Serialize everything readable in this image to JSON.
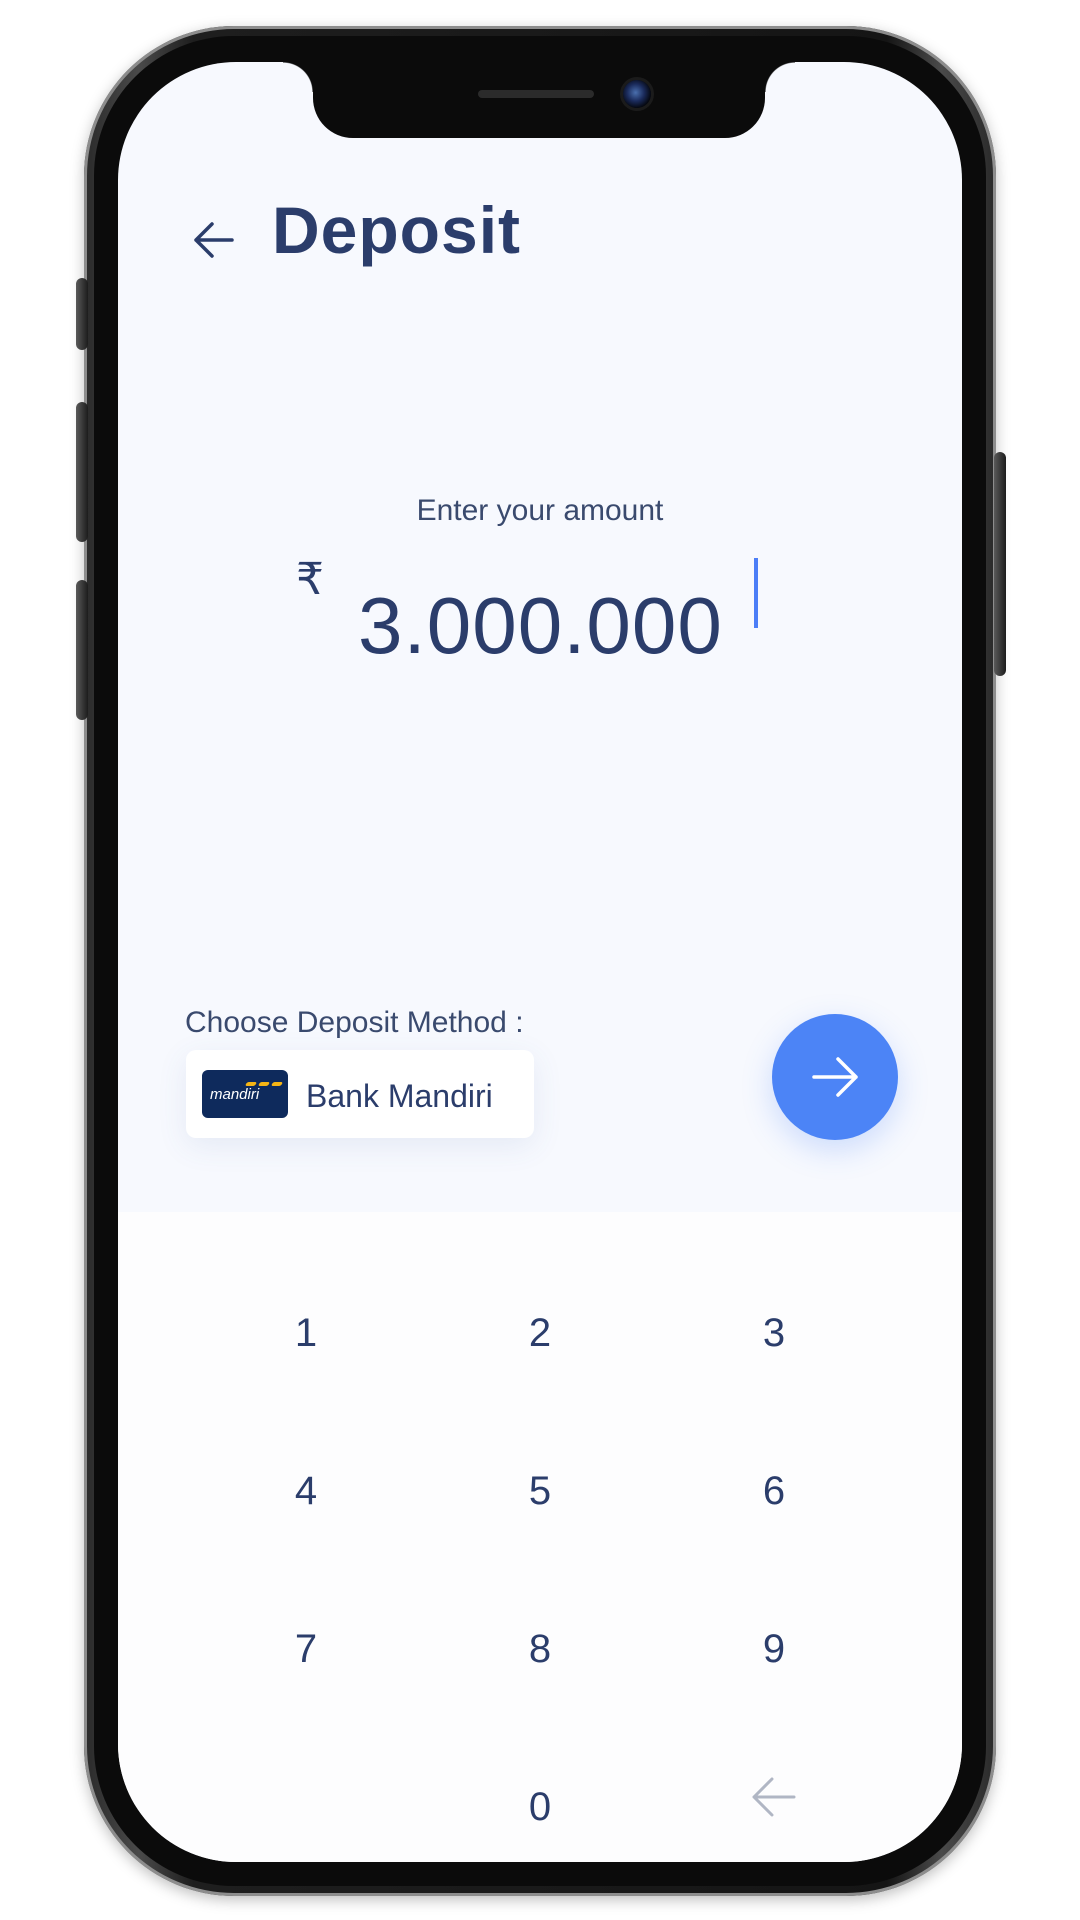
{
  "header": {
    "title": "Deposit",
    "back_icon": "arrow-left-icon"
  },
  "amount": {
    "label": "Enter your amount",
    "currency_symbol": "₹",
    "value": "3.000.000"
  },
  "deposit_method": {
    "label": "Choose Deposit Method :",
    "selected": {
      "logo_text": "mandiri",
      "name": "Bank Mandiri"
    }
  },
  "next_button": {
    "icon": "arrow-right-icon"
  },
  "keypad": {
    "keys": [
      "1",
      "2",
      "3",
      "4",
      "5",
      "6",
      "7",
      "8",
      "9",
      "0"
    ],
    "backspace_icon": "arrow-left-icon"
  },
  "colors": {
    "accent": "#4c84f6",
    "text": "#2b3d6b",
    "background": "#f7f9fe",
    "bank_logo_bg": "#0e2a5c",
    "bank_logo_accent": "#f5b515"
  }
}
